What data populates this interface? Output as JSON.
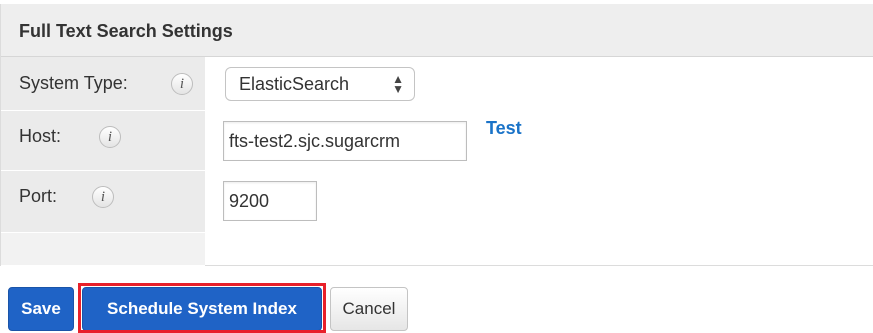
{
  "panel": {
    "title": "Full Text Search Settings"
  },
  "fields": {
    "system_type": {
      "label": "System Type:",
      "value": "ElasticSearch",
      "info_icon": "i"
    },
    "host": {
      "label": "Host:",
      "value": "fts-test2.sjc.sugarcrm",
      "info_icon": "i",
      "test_link": "Test"
    },
    "port": {
      "label": "Port:",
      "value": "9200",
      "info_icon": "i"
    }
  },
  "buttons": {
    "save": "Save",
    "schedule": "Schedule System Index",
    "cancel": "Cancel"
  },
  "colors": {
    "primary": "#1f63c6",
    "link": "#1a73c8",
    "highlight": "#e8202a",
    "label_bg": "#ebebeb"
  },
  "icons": [
    "info-icon",
    "select-arrows-icon"
  ]
}
